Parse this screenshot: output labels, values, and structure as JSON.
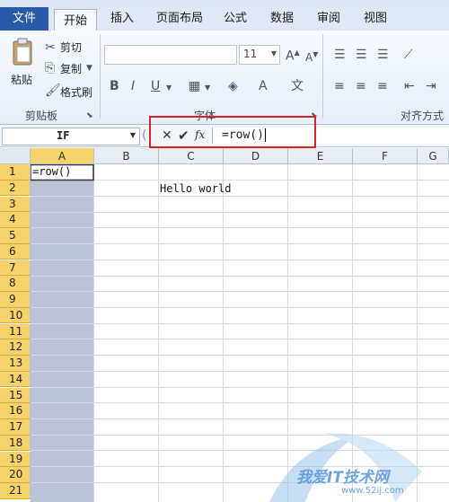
{
  "tabs": [
    "文件",
    "开始",
    "插入",
    "页面布局",
    "公式",
    "数据",
    "审阅",
    "视图"
  ],
  "clipboard": {
    "paste": "粘贴",
    "cut": "剪切",
    "copy": "复制",
    "format_painter": "格式刷",
    "group_label": "剪贴板"
  },
  "font": {
    "size": "11",
    "group_label": "字体"
  },
  "alignment": {
    "group_label": "对齐方式"
  },
  "formula_bar": {
    "name_box": "IF",
    "fx": "fx",
    "formula": "=row()"
  },
  "columns": [
    "A",
    "B",
    "C",
    "D",
    "E",
    "F",
    "G"
  ],
  "rows": [
    "1",
    "2",
    "3",
    "4",
    "5",
    "6",
    "7",
    "8",
    "9",
    "10",
    "11",
    "12",
    "13",
    "14",
    "15",
    "16",
    "17",
    "18",
    "19",
    "20",
    "21"
  ],
  "cells": {
    "A1": "=row()",
    "C2": "Hello world"
  },
  "watermark": {
    "text": "我爱IT技术网",
    "url": "www.52ij.com"
  },
  "colors": {
    "selection": "#bcc3d8",
    "active_header": "#f6d36a",
    "highlight_box": "#d32525"
  }
}
